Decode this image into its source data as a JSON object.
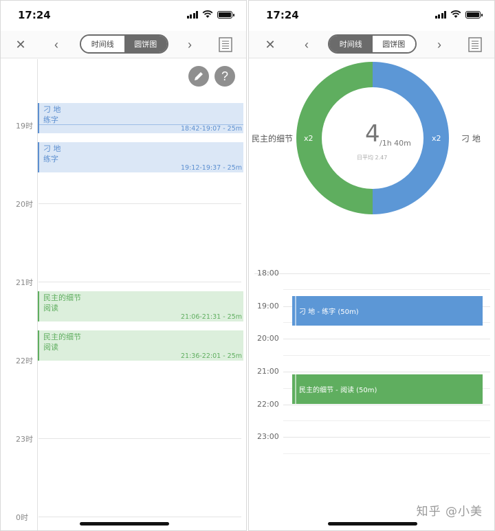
{
  "status_bar": {
    "time": "17:24"
  },
  "toggle": {
    "timeline": "时间线",
    "pie": "圆饼图"
  },
  "left": {
    "hours": [
      "19时",
      "20时",
      "21时",
      "22时",
      "23时",
      "0时"
    ],
    "help_symbol": "?",
    "events": [
      {
        "title": "刁 地",
        "sub": "练字",
        "time": "18:42-19:07 - 25m",
        "color": "blue"
      },
      {
        "title": "刁 地",
        "sub": "练字",
        "time": "19:12-19:37 - 25m",
        "color": "blue"
      },
      {
        "title": "民主的细节",
        "sub": "阅读",
        "time": "21:06-21:31 - 25m",
        "color": "green"
      },
      {
        "title": "民主的细节",
        "sub": "阅读",
        "time": "21:36-22:01 - 25m",
        "color": "green"
      }
    ]
  },
  "right": {
    "pie": {
      "center_count": "4",
      "center_total": "/1h 40m",
      "daily_avg": "日平均 2.47",
      "left_label": "民主的细节",
      "right_label": "刁 地",
      "left_count": "x2",
      "right_count": "x2",
      "colors": {
        "green": "#5fae5f",
        "blue": "#5c97d6"
      },
      "slices": [
        {
          "name": "刁 地",
          "value": 50
        },
        {
          "name": "民主的细节",
          "value": 50
        }
      ]
    },
    "hours": [
      "18:00",
      "19:00",
      "20:00",
      "21:00",
      "22:00",
      "23:00"
    ],
    "bars": [
      {
        "label": "刁 地 - 练字 (50m)",
        "color": "blue"
      },
      {
        "label": "民主的细节 - 阅读 (50m)",
        "color": "green"
      }
    ]
  },
  "watermark": "知乎 @小美"
}
